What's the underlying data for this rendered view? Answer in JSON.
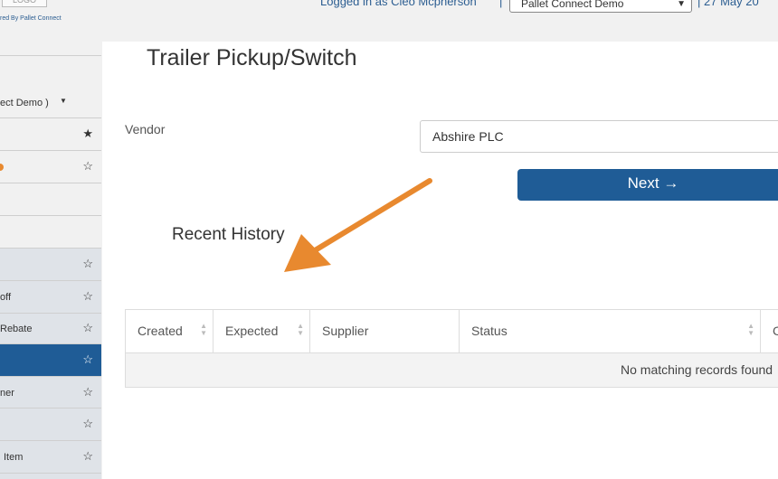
{
  "header": {
    "logo_text": "LOGO",
    "powered_by": "red By Pallet Connect",
    "logged_in": "Logged in as Cleo Mcpherson",
    "separator": "|",
    "company_select_value": "Pallet Connect Demo",
    "date": "27 May 20"
  },
  "sidebar": {
    "company_dropdown": "ect Demo )",
    "items": [
      {
        "label": "",
        "star": "★"
      },
      {
        "label": "",
        "star": "☆"
      },
      {
        "label": "",
        "star": ""
      },
      {
        "label": "",
        "star": ""
      },
      {
        "label": "",
        "star": "☆"
      },
      {
        "label": "off",
        "star": "☆"
      },
      {
        "label": "Rebate",
        "star": "☆"
      },
      {
        "label": "",
        "star": "☆"
      },
      {
        "label": "ner",
        "star": "☆"
      },
      {
        "label": "",
        "star": "☆"
      },
      {
        "label": "Item",
        "star": "☆"
      }
    ]
  },
  "main": {
    "title": "Trailer Pickup/Switch",
    "vendor_label": "Vendor",
    "vendor_value": "Abshire PLC",
    "next_button": "Next →",
    "recent_history": "Recent History",
    "table": {
      "columns": [
        "Created",
        "Expected",
        "Supplier",
        "Status",
        "C"
      ],
      "empty_message": "No matching records found"
    }
  },
  "colors": {
    "primary": "#1f5c96",
    "arrow": "#e8892f",
    "sidebar_bg": "#f1f1f1",
    "sidebar_grey": "#dfe3e8"
  },
  "icons": [
    "star-filled-icon",
    "star-outline-icon",
    "arrow-right-icon",
    "sort-icon",
    "caret-down-icon"
  ]
}
